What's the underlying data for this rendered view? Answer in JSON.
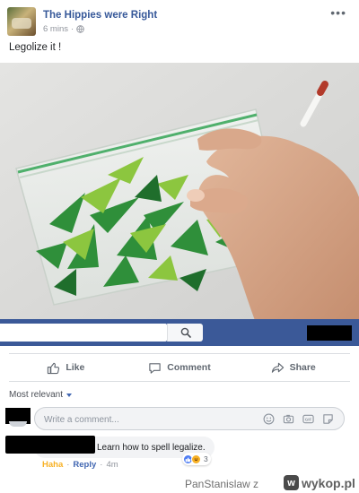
{
  "post": {
    "page_name": "The Hippies were Right",
    "timestamp": "6 mins",
    "privacy_icon": "globe-icon",
    "more_label": "•••",
    "text": "Legolize it !"
  },
  "search": {
    "value": "",
    "button_icon": "search-icon"
  },
  "actions": {
    "like_label": "Like",
    "comment_label": "Comment",
    "share_label": "Share"
  },
  "comments": {
    "sort_label": "Most relevant",
    "input_placeholder": "Write a comment...",
    "input_value": "",
    "input_icons": [
      "emoji-icon",
      "camera-icon",
      "gif-icon",
      "sticker-icon"
    ],
    "items": [
      {
        "author": "",
        "text": "Learn how to spell legalize.",
        "reaction_name": "Haha",
        "reply_label": "Reply",
        "time": "4m",
        "reaction_count": "3"
      }
    ]
  },
  "watermark": {
    "user": "PanStanislaw  z",
    "site": "wykop.pl"
  },
  "colors": {
    "facebook_blue": "#3b5998",
    "link_blue": "#365899",
    "haha_yellow": "#f7b125"
  }
}
